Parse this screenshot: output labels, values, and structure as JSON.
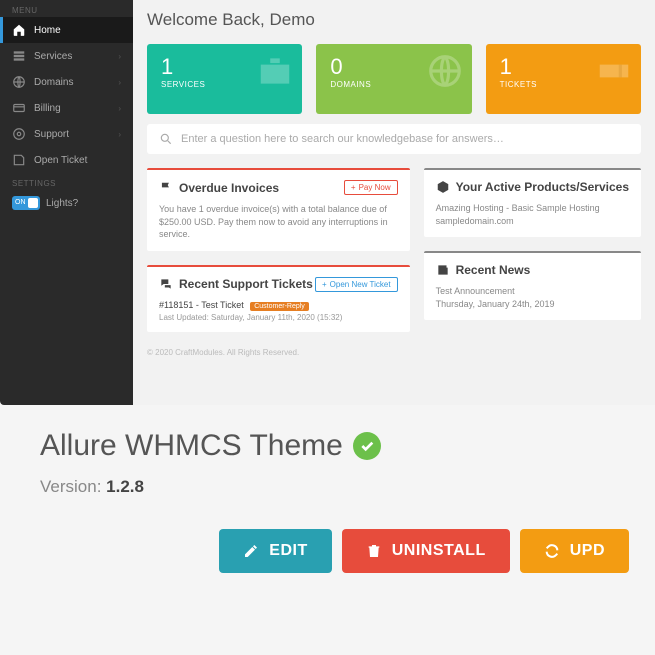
{
  "sidebar": {
    "menu_header": "MENU",
    "items": [
      {
        "label": "Home",
        "active": true
      },
      {
        "label": "Services",
        "sub": true
      },
      {
        "label": "Domains",
        "sub": true
      },
      {
        "label": "Billing",
        "sub": true
      },
      {
        "label": "Support",
        "sub": true
      },
      {
        "label": "Open Ticket"
      }
    ],
    "settings_header": "SETTINGS",
    "toggle_text": "ON",
    "lights_label": "Lights?"
  },
  "welcome": "Welcome Back, Demo",
  "stats": [
    {
      "num": "1",
      "label": "SERVICES"
    },
    {
      "num": "0",
      "label": "DOMAINS"
    },
    {
      "num": "1",
      "label": "TICKETS"
    }
  ],
  "search_placeholder": "Enter a question here to search our knowledgebase for answers…",
  "cards": {
    "overdue": {
      "title": "Overdue Invoices",
      "btn_plus": "+",
      "btn": "Pay Now",
      "body": "You have 1 overdue invoice(s) with a total balance due of $250.00 USD. Pay them now to avoid any interruptions in service."
    },
    "tickets": {
      "title": "Recent Support Tickets",
      "btn_plus": "+",
      "btn": "Open New Ticket",
      "subject": "#118151 - Test Ticket",
      "badge": "Customer-Reply",
      "updated": "Last Updated: Saturday, January 11th, 2020 (15:32)"
    },
    "active": {
      "title": "Your Active Products/Services",
      "body": "Amazing Hosting - Basic Sample Hosting sampledomain.com"
    },
    "news": {
      "title": "Recent News",
      "body": "Test Announcement",
      "date": "Thursday, January 24th, 2019"
    }
  },
  "footer": "© 2020 CraftModules. All Rights Reserved.",
  "product": {
    "title": "Allure WHMCS Theme",
    "version_prefix": "Version: ",
    "version": "1.2.8",
    "edit": "EDIT",
    "uninstall": "UNINSTALL",
    "update": "UPD"
  }
}
